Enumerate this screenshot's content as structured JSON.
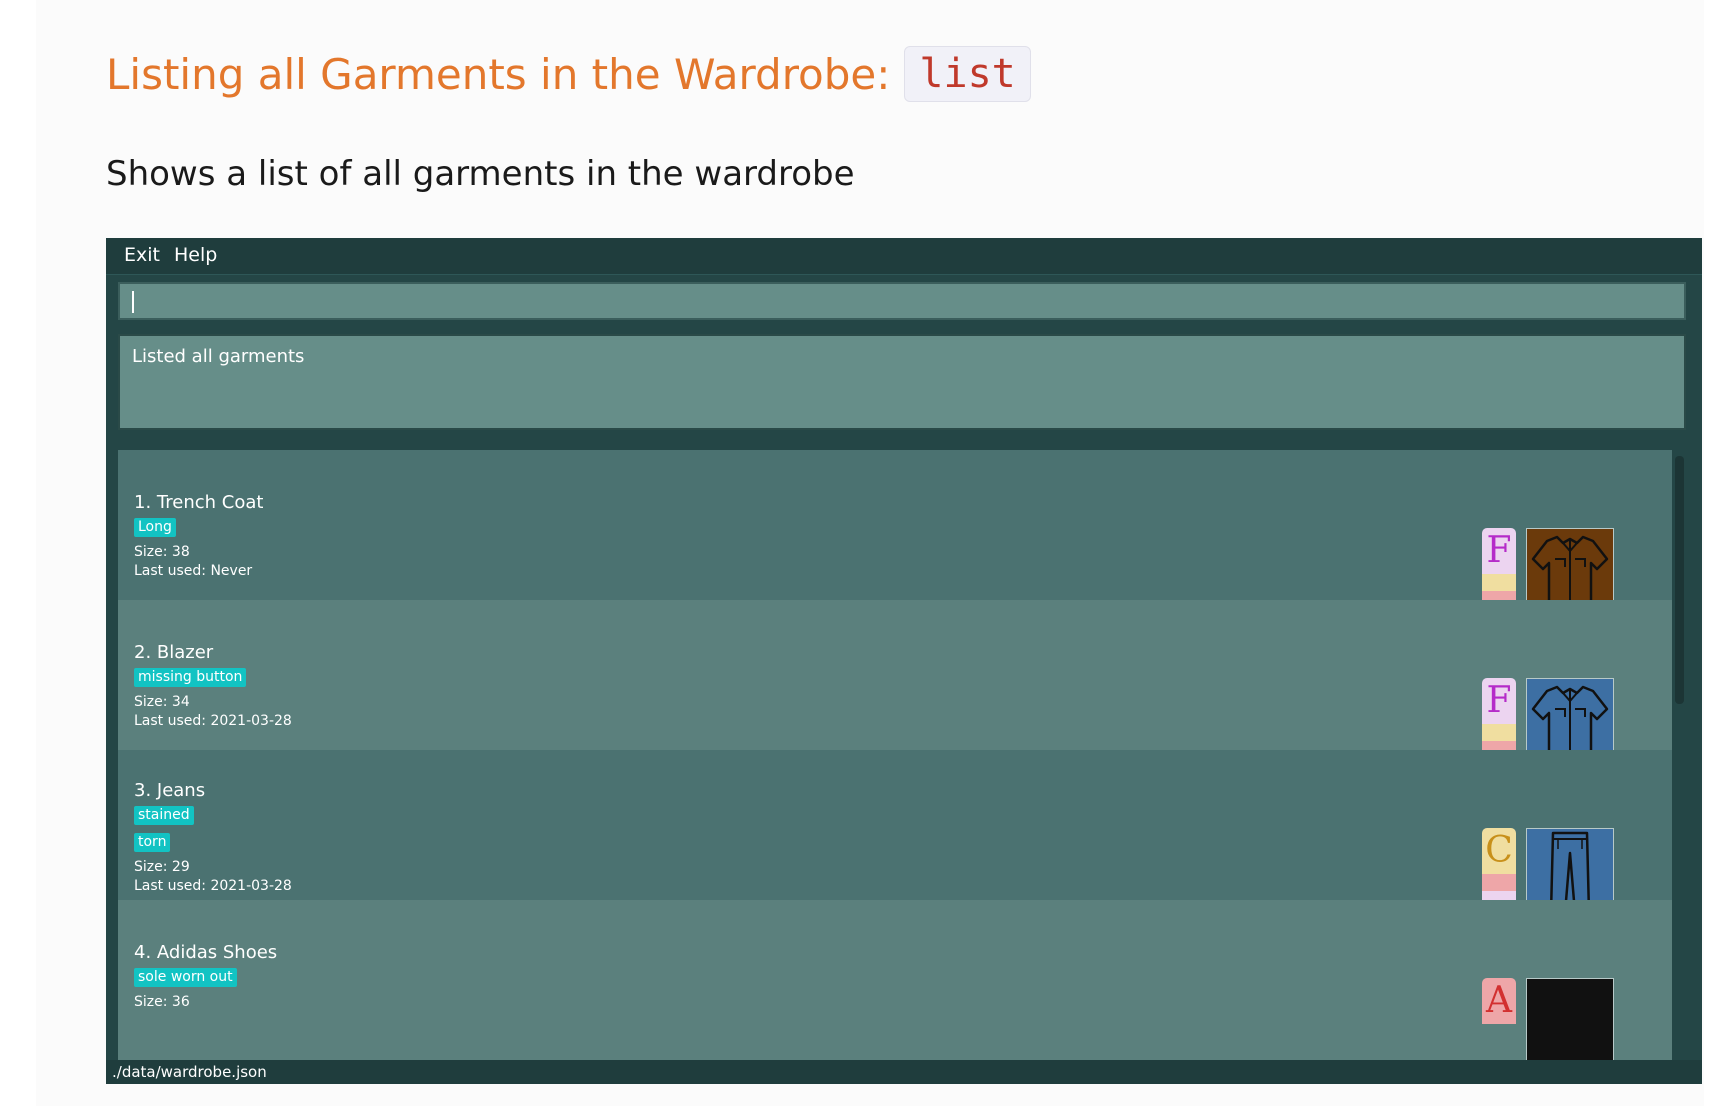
{
  "doc": {
    "heading": "Listing all Garments in the Wardrobe:",
    "heading_code": "list",
    "description": "Shows a list of all garments in the wardrobe"
  },
  "app": {
    "menu": {
      "exit": "Exit",
      "help": "Help"
    },
    "command_input": {
      "value": ""
    },
    "result": "Listed all garments",
    "status": "./data/wardrobe.json",
    "garments": [
      {
        "title": "1.  Trench Coat",
        "tags": [
          "Long"
        ],
        "size": "Size: 38",
        "last_used": "Last used: Never",
        "badge_letter": "F",
        "icon": "shirt-icon",
        "color": "#6b3a0b"
      },
      {
        "title": "2.  Blazer",
        "tags": [
          "missing button"
        ],
        "size": "Size: 34",
        "last_used": "Last used: 2021-03-28",
        "badge_letter": "F",
        "icon": "shirt-icon",
        "color": "#3d6fa3"
      },
      {
        "title": "3.  Jeans",
        "tags": [
          "stained",
          "torn"
        ],
        "size": "Size: 29",
        "last_used": "Last used: 2021-03-28",
        "badge_letter": "C",
        "icon": "jeans-icon",
        "color": "#3d6fa3"
      },
      {
        "title": "4.  Adidas Shoes",
        "tags": [
          "sole worn out"
        ],
        "size": "Size: 36",
        "last_used": "",
        "badge_letter": "A",
        "icon": "shoe-icon",
        "color": "#111111"
      }
    ]
  }
}
